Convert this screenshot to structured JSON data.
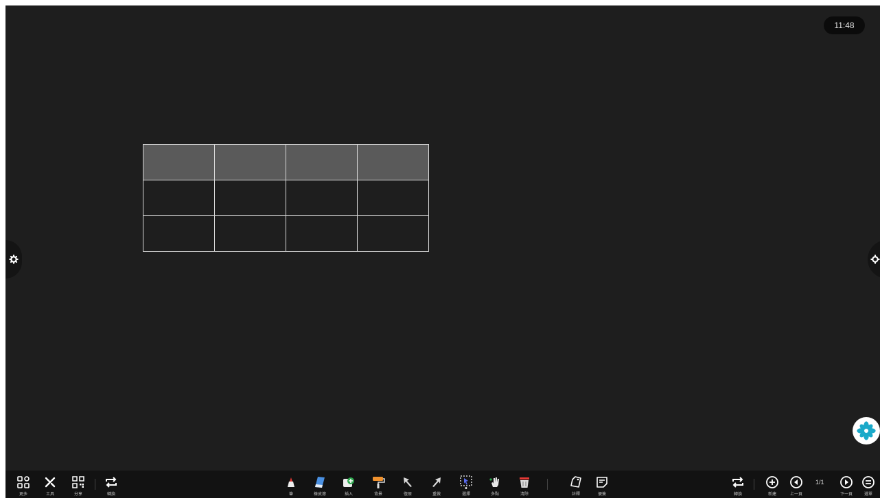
{
  "clock": "11:48",
  "table": {
    "rows": 3,
    "cols": 4,
    "header_fill": "#5a5a5a",
    "border_color": "#d9d9d9"
  },
  "toolbar": {
    "left": [
      {
        "icon": "grid-apps-icon",
        "label": "更多"
      },
      {
        "icon": "tools-icon",
        "label": "工具"
      },
      {
        "icon": "qr-code-icon",
        "label": "分享"
      },
      {
        "icon": "switch-icon",
        "label": "轉換"
      }
    ],
    "center": [
      {
        "icon": "pen-icon",
        "label": "筆"
      },
      {
        "icon": "eraser-icon",
        "label": "橡皮擦"
      },
      {
        "icon": "insert-icon",
        "label": "插入"
      },
      {
        "icon": "background-roller-icon",
        "label": "背景"
      },
      {
        "icon": "undo-icon",
        "label": "復原"
      },
      {
        "icon": "redo-icon",
        "label": "重做"
      },
      {
        "icon": "select-icon",
        "label": "選擇"
      },
      {
        "icon": "multi-touch-hand-icon",
        "label": "多點"
      },
      {
        "icon": "clear-trash-icon",
        "label": "清除"
      }
    ],
    "center_extra": [
      {
        "icon": "annotation-tag-icon",
        "label": "註釋"
      },
      {
        "icon": "sticky-note-icon",
        "label": "便簽"
      }
    ],
    "right": [
      {
        "icon": "switch-icon",
        "label": "轉換"
      },
      {
        "icon": "new-page-icon",
        "label": "新建"
      },
      {
        "icon": "previous-page-icon",
        "label": "上一頁"
      },
      {
        "icon": "next-page-icon",
        "label": "下一頁"
      },
      {
        "icon": "menu-icon",
        "label": "選單"
      }
    ],
    "page_indicator": "1/1"
  },
  "colors": {
    "canvas": "#1e1e1e",
    "toolbar": "#121212",
    "accent_teal": "#1aa9c9"
  }
}
